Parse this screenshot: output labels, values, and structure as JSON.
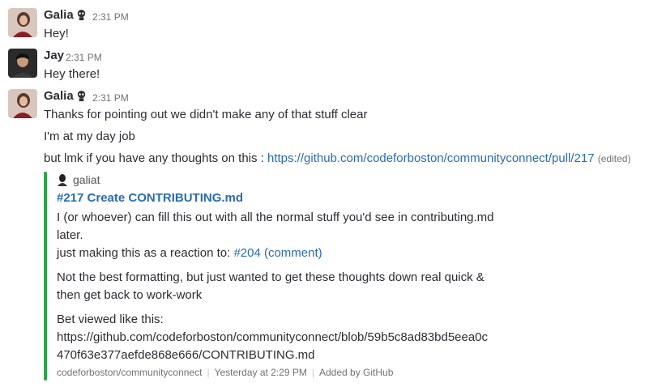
{
  "messages": [
    {
      "author": "Galia",
      "time": "2:31 PM",
      "lines": [
        "Hey!"
      ]
    },
    {
      "author": "Jay",
      "time": "2:31 PM",
      "lines": [
        "Hey there!"
      ]
    },
    {
      "author": "Galia",
      "time": "2:31 PM",
      "lines": [
        "Thanks for pointing out we didn't make any of that stuff clear",
        "I'm at my day job"
      ],
      "link_line": {
        "prefix": "but lmk if you have any thoughts on this : ",
        "url": "https://github.com/codeforboston/communityconnect/pull/217",
        "edited": "(edited)"
      }
    }
  ],
  "attachment": {
    "author": "galiat",
    "title": "#217 Create CONTRIBUTING.md",
    "body_lines": [
      "I (or whoever) can fill this out with all the normal stuff you'd see in contributing.md",
      "later."
    ],
    "reaction_prefix": "just making this as a reaction to: ",
    "reaction_link": "#204 (comment)",
    "para2": [
      "Not the best formatting, but just wanted to get these thoughts down real quick &",
      "then get back to work-work"
    ],
    "para3_label": "Bet viewed like this:",
    "para3_link": [
      "https://github.com/codeforboston/communityconnect/blob/59b5c8ad83bd5eea0c",
      "470f63e377aefde868e666/CONTRIBUTING.md"
    ],
    "footer": {
      "repo": "codeforboston/communityconnect",
      "time": "Yesterday at 2:29 PM",
      "source": "Added by GitHub"
    },
    "bar_color": "#2fa34a"
  },
  "colors": {
    "link": "#2a6cb0",
    "muted": "#717274",
    "text": "#2c2d30"
  }
}
